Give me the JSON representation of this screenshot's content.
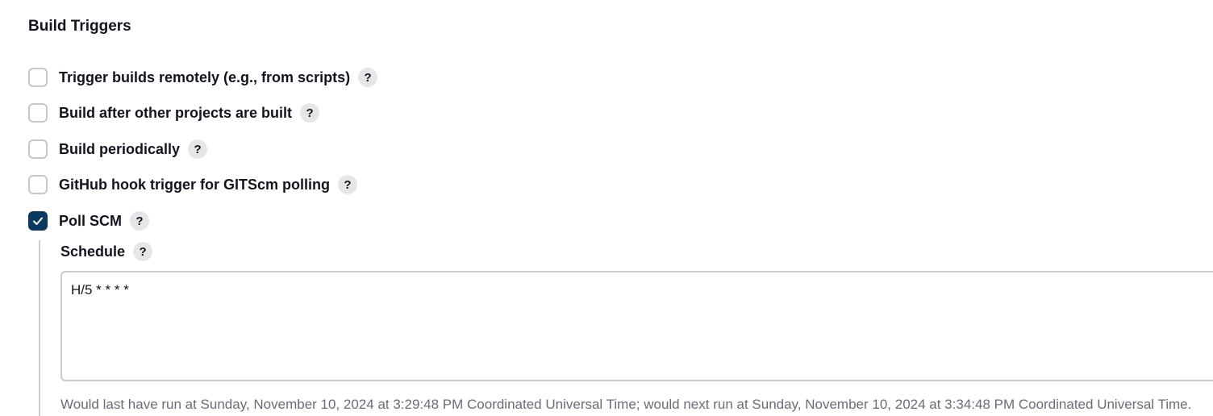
{
  "section": {
    "title": "Build Triggers"
  },
  "triggers": [
    {
      "label": "Trigger builds remotely (e.g., from scripts)",
      "checked": false,
      "help": "?"
    },
    {
      "label": "Build after other projects are built",
      "checked": false,
      "help": "?"
    },
    {
      "label": "Build periodically",
      "checked": false,
      "help": "?"
    },
    {
      "label": "GitHub hook trigger for GITScm polling",
      "checked": false,
      "help": "?"
    },
    {
      "label": "Poll SCM",
      "checked": true,
      "help": "?"
    }
  ],
  "schedule": {
    "label": "Schedule",
    "help": "?",
    "value": "H/5 * * * *",
    "info": "Would last have run at Sunday, November 10, 2024 at 3:29:48 PM Coordinated Universal Time; would next run at Sunday, November 10, 2024 at 3:34:48 PM Coordinated Universal Time."
  },
  "colors": {
    "checkbox_checked": "#0b3a5e",
    "checkbox_border": "#c4c8ce",
    "help_bg": "#e6e6e8",
    "info_text": "#696d78"
  },
  "icons": {
    "check": "checkmark-icon",
    "help": "help-icon"
  }
}
